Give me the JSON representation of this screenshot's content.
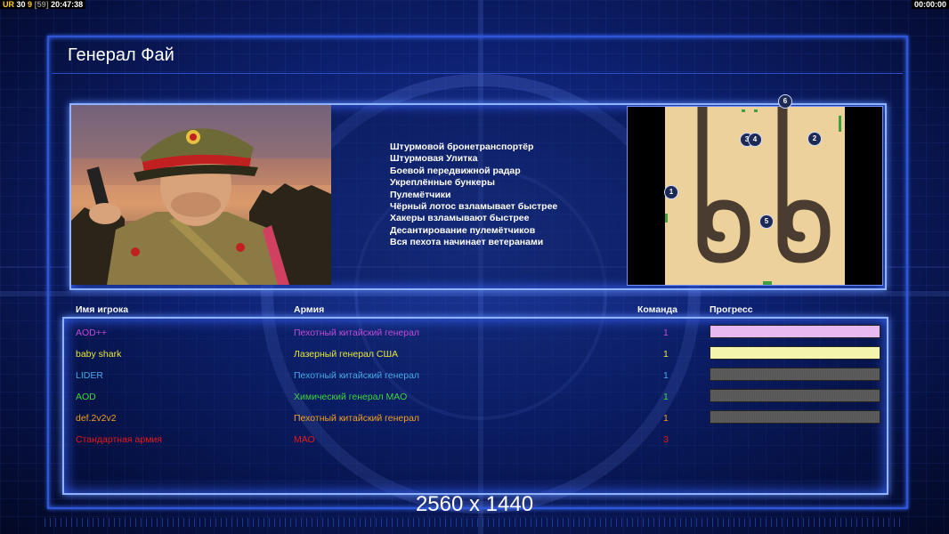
{
  "hud": {
    "left_label": "UR",
    "left_num1": "30",
    "left_num2": "9",
    "left_bracket": "[59]",
    "left_time": "20:47:38",
    "right_time": "00:00:00"
  },
  "general": {
    "title": "Генерал Фай",
    "features": [
      "Штурмовой бронетранспортёр",
      "Штурмовая Улитка",
      "Боевой передвижной радар",
      "Укреплённые бункеры",
      "Пулемётчики",
      "Чёрный лотос взламывает быстрее",
      "Хакеры взламывают быстрее",
      "Десантирование пулемётчиков",
      "Вся пехота начинает ветеранами"
    ]
  },
  "map": {
    "markers": [
      "6",
      "3",
      "4",
      "2",
      "1",
      "5"
    ]
  },
  "table": {
    "headers": {
      "name": "Имя игрока",
      "army": "Армия",
      "team": "Команда",
      "progress": "Прогресс"
    },
    "rows": [
      {
        "name": "AOD++",
        "army": "Пехотный китайский генерал",
        "team": "1",
        "color": "#c04cd8",
        "progress": 1.0,
        "bar_color": "#d070e0"
      },
      {
        "name": "baby shark",
        "army": "Лазерный генерал США",
        "team": "1",
        "color": "#e6e63a",
        "progress": 1.0,
        "bar_color": "#e8e85a"
      },
      {
        "name": "LIDER",
        "army": "Пехотный китайский генерал",
        "team": "1",
        "color": "#46a8e8",
        "progress": 0.0,
        "bar_color": "#4aa0e0"
      },
      {
        "name": "AOD",
        "army": "Химический генерал МАО",
        "team": "1",
        "color": "#3cd63c",
        "progress": 0.0,
        "bar_color": "#40d040"
      },
      {
        "name": "def.2v2v2",
        "army": "Пехотный китайский генерал",
        "team": "1",
        "color": "#f0a020",
        "progress": 0.0,
        "bar_color": "#f0a020"
      },
      {
        "name": "Стандартная армия",
        "army": "МАО",
        "team": "3",
        "color": "#e81818",
        "progress": null,
        "bar_color": ""
      }
    ]
  },
  "resolution": "2560 x 1440"
}
